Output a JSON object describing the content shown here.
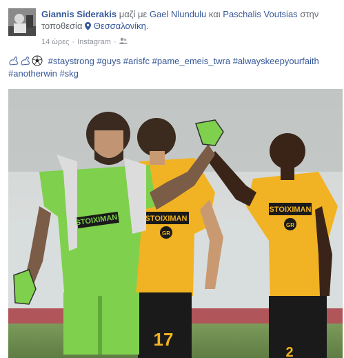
{
  "post": {
    "author": "Giannis Siderakis",
    "with_word": "μαζί με",
    "tagged1": "Gael Nlundulu",
    "and_word": "και",
    "tagged2": "Paschalis Voutsias",
    "location_prefix": "στην τοποθεσία",
    "location": "Θεσσαλονίκη.",
    "time": "14 ώρες",
    "separator": "·",
    "source": "Instagram",
    "separator2": "·",
    "hashtags_line1": "#staystrong #guys #arisfc #pame_emeis_twra #alwayskeepyourfaith",
    "hashtags_line2": "#anotherwin #skg"
  },
  "photo": {
    "jersey_sponsor": "STOIXIMAN",
    "jersey_sub": "GR",
    "player_number": "17",
    "number_right": "2"
  },
  "icons": {
    "avatar": "avatar-photo",
    "location": "map-pin-icon",
    "audience": "friends-icon",
    "emojis": [
      "flexed-arm-emoji",
      "flexed-arm-emoji",
      "soccer-ball-emoji"
    ]
  },
  "colors": {
    "link": "#365899",
    "meta": "#90949c",
    "goalkeeper_green": "#7fd24e",
    "aris_yellow": "#f0b020"
  }
}
